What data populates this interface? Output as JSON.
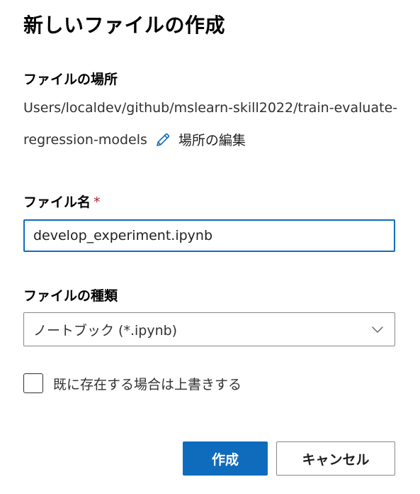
{
  "dialog": {
    "title": "新しいファイルの作成"
  },
  "location": {
    "label": "ファイルの場所",
    "path_line1": "Users/localdev/github/mslearn-skill2022/train-evaluate-",
    "path_line2": "regression-models",
    "edit_label": "場所の編集",
    "edit_icon": "pencil-icon"
  },
  "filename": {
    "label": "ファイル名",
    "required_mark": "*",
    "value": "develop_experiment.ipynb"
  },
  "filetype": {
    "label": "ファイルの種類",
    "selected": "ノートブック (*.ipynb)",
    "dropdown_icon": "chevron-down-icon"
  },
  "overwrite": {
    "label": "既に存在する場合は上書きする",
    "checked": false
  },
  "buttons": {
    "create": "作成",
    "cancel": "キャンセル"
  },
  "colors": {
    "accent": "#0f6cbd",
    "required": "#a4262c",
    "border": "#8a8886"
  }
}
